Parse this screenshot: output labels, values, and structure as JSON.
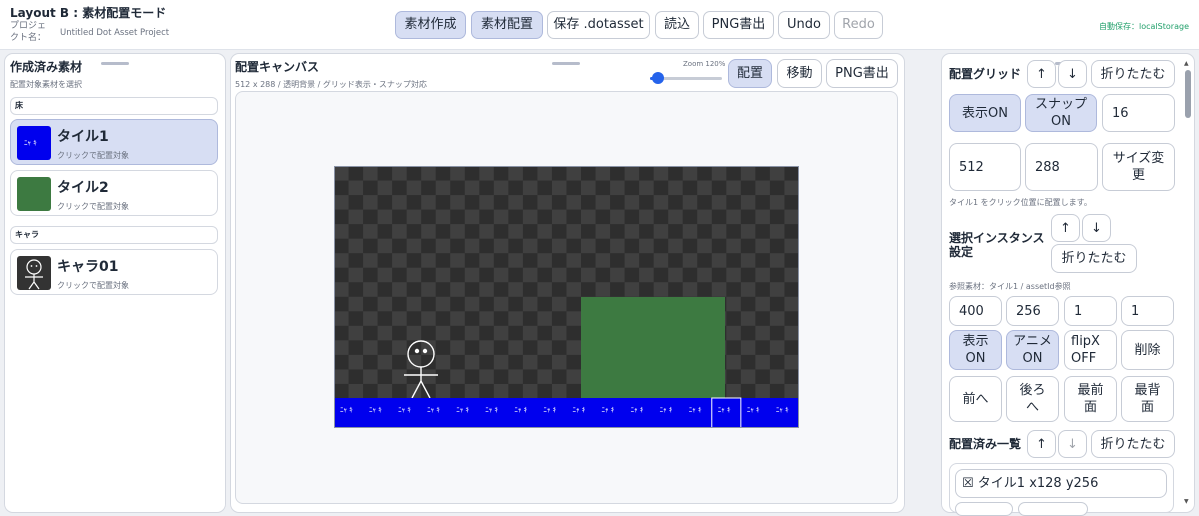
{
  "header": {
    "title": "Layout B : 素材配置モード",
    "project_label": "プロジェクト名：",
    "project_name": "Untitled Dot Asset Project",
    "autosave": "自動保存：localStorage",
    "buttons": {
      "create": "素材作成",
      "place": "素材配置",
      "save": "保存 .dotasset",
      "load": "読込",
      "png": "PNG書出",
      "undo": "Undo",
      "redo": "Redo"
    }
  },
  "assets_panel": {
    "title": "作成済み素材",
    "subtitle": "配置対象素材を選択",
    "groups": [
      {
        "name": "床"
      },
      {
        "name": "キャラ"
      }
    ],
    "items": [
      {
        "name": "タイル1",
        "hint": "クリックで配置対象",
        "thumb_text": "ﾆｬ ｷ",
        "color": "#0000ee"
      },
      {
        "name": "タイル2",
        "hint": "クリックで配置対象",
        "color": "#3d7a41"
      },
      {
        "name": "キャラ01",
        "hint": "クリックで配置対象",
        "color": "#333333"
      }
    ]
  },
  "canvas_panel": {
    "title": "配置キャンバス",
    "subtitle": "512 x 288 / 透明背景 / グリッド表示・スナップ対応",
    "zoom_label": "Zoom 120%",
    "zoom_percent": 120,
    "buttons": {
      "place": "配置",
      "move": "移動",
      "png": "PNG書出"
    },
    "tile_text": "ﾆｬ ｷ"
  },
  "right_panel": {
    "grid": {
      "title": "配置グリッド",
      "up": "↑",
      "down": "↓",
      "collapse": "折りたたむ",
      "show_on": "表示ON",
      "snap_on": "スナップON",
      "size": "16",
      "width": "512",
      "height": "288",
      "resize": "サイズ変更",
      "hint": "タイル1 をクリック位置に配置します。"
    },
    "instance": {
      "title": "選択インスタンス設定",
      "up": "↑",
      "down": "↓",
      "collapse": "折りたたむ",
      "ref": "参照素材：タイル1 / assetId参照",
      "x": "400",
      "y": "256",
      "scale_x": "1",
      "scale_y": "1",
      "visible": "表示ON",
      "anim": "アニメON",
      "flip": "flipX OFF",
      "delete": "削除",
      "forward": "前へ",
      "backward": "後ろへ",
      "front": "最前面",
      "back": "最背面"
    },
    "placed": {
      "title": "配置済み一覧",
      "up": "↑",
      "down": "↓",
      "collapse": "折りたたむ",
      "first_item": "☒ タイル1 x128 y256"
    }
  },
  "colors": {
    "accent": "#2563eb",
    "active_bg": "#d7def3",
    "tile_blue": "#0000ee",
    "tile_green": "#3d7a41",
    "checker_dark": "#2e2e2e",
    "checker_light": "#404040",
    "autosave": "#22a06b"
  }
}
